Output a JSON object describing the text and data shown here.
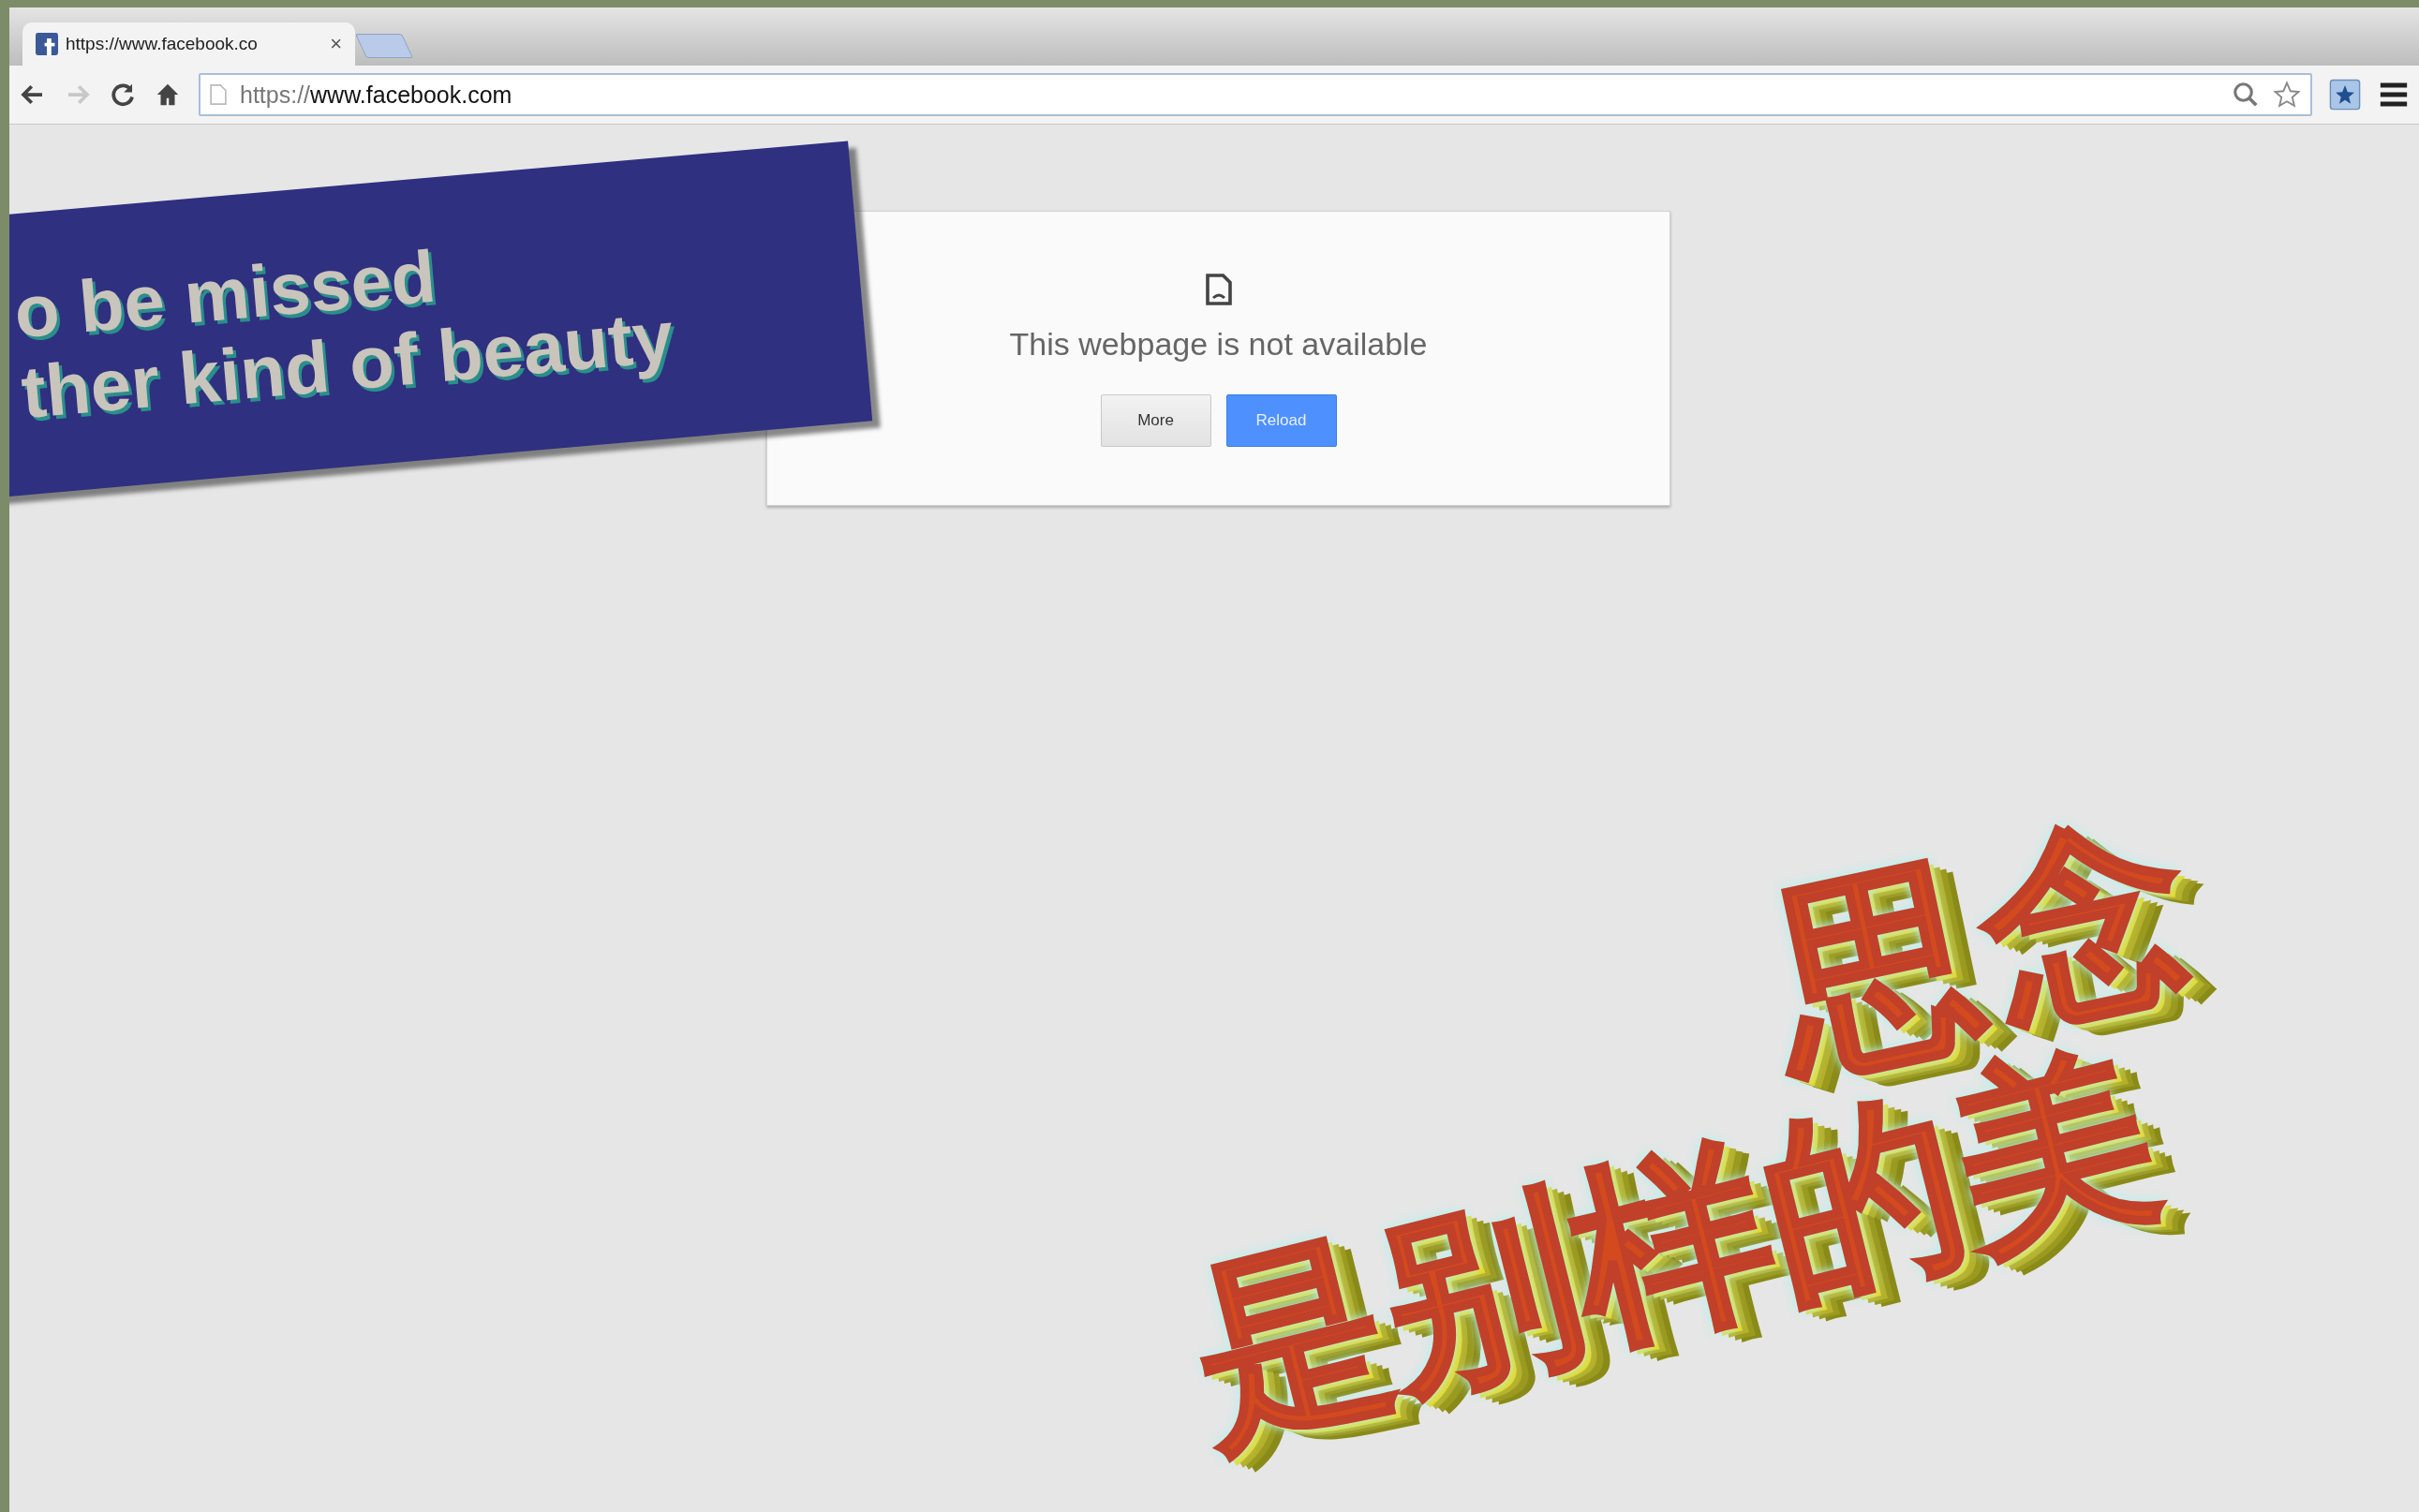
{
  "tabs": [
    {
      "title": "https://www.facebook.co",
      "close": "×",
      "selected": true
    }
  ],
  "toolbar": {
    "forward_disabled": true,
    "url": "https://**www.facebook.com**"
  },
  "error_card": {
    "title": "This webpage is not available",
    "buttons": [
      {
        "label": "More",
        "primary": false
      },
      {
        "label": "Reload",
        "primary": true
      }
    ]
  },
  "caption_banner": {
    "lines": [
      "o be missed",
      "ther kind of beauty"
    ]
  },
  "chinese_art": {
    "lines": [
      "思念",
      "是别样的美"
    ]
  }
}
